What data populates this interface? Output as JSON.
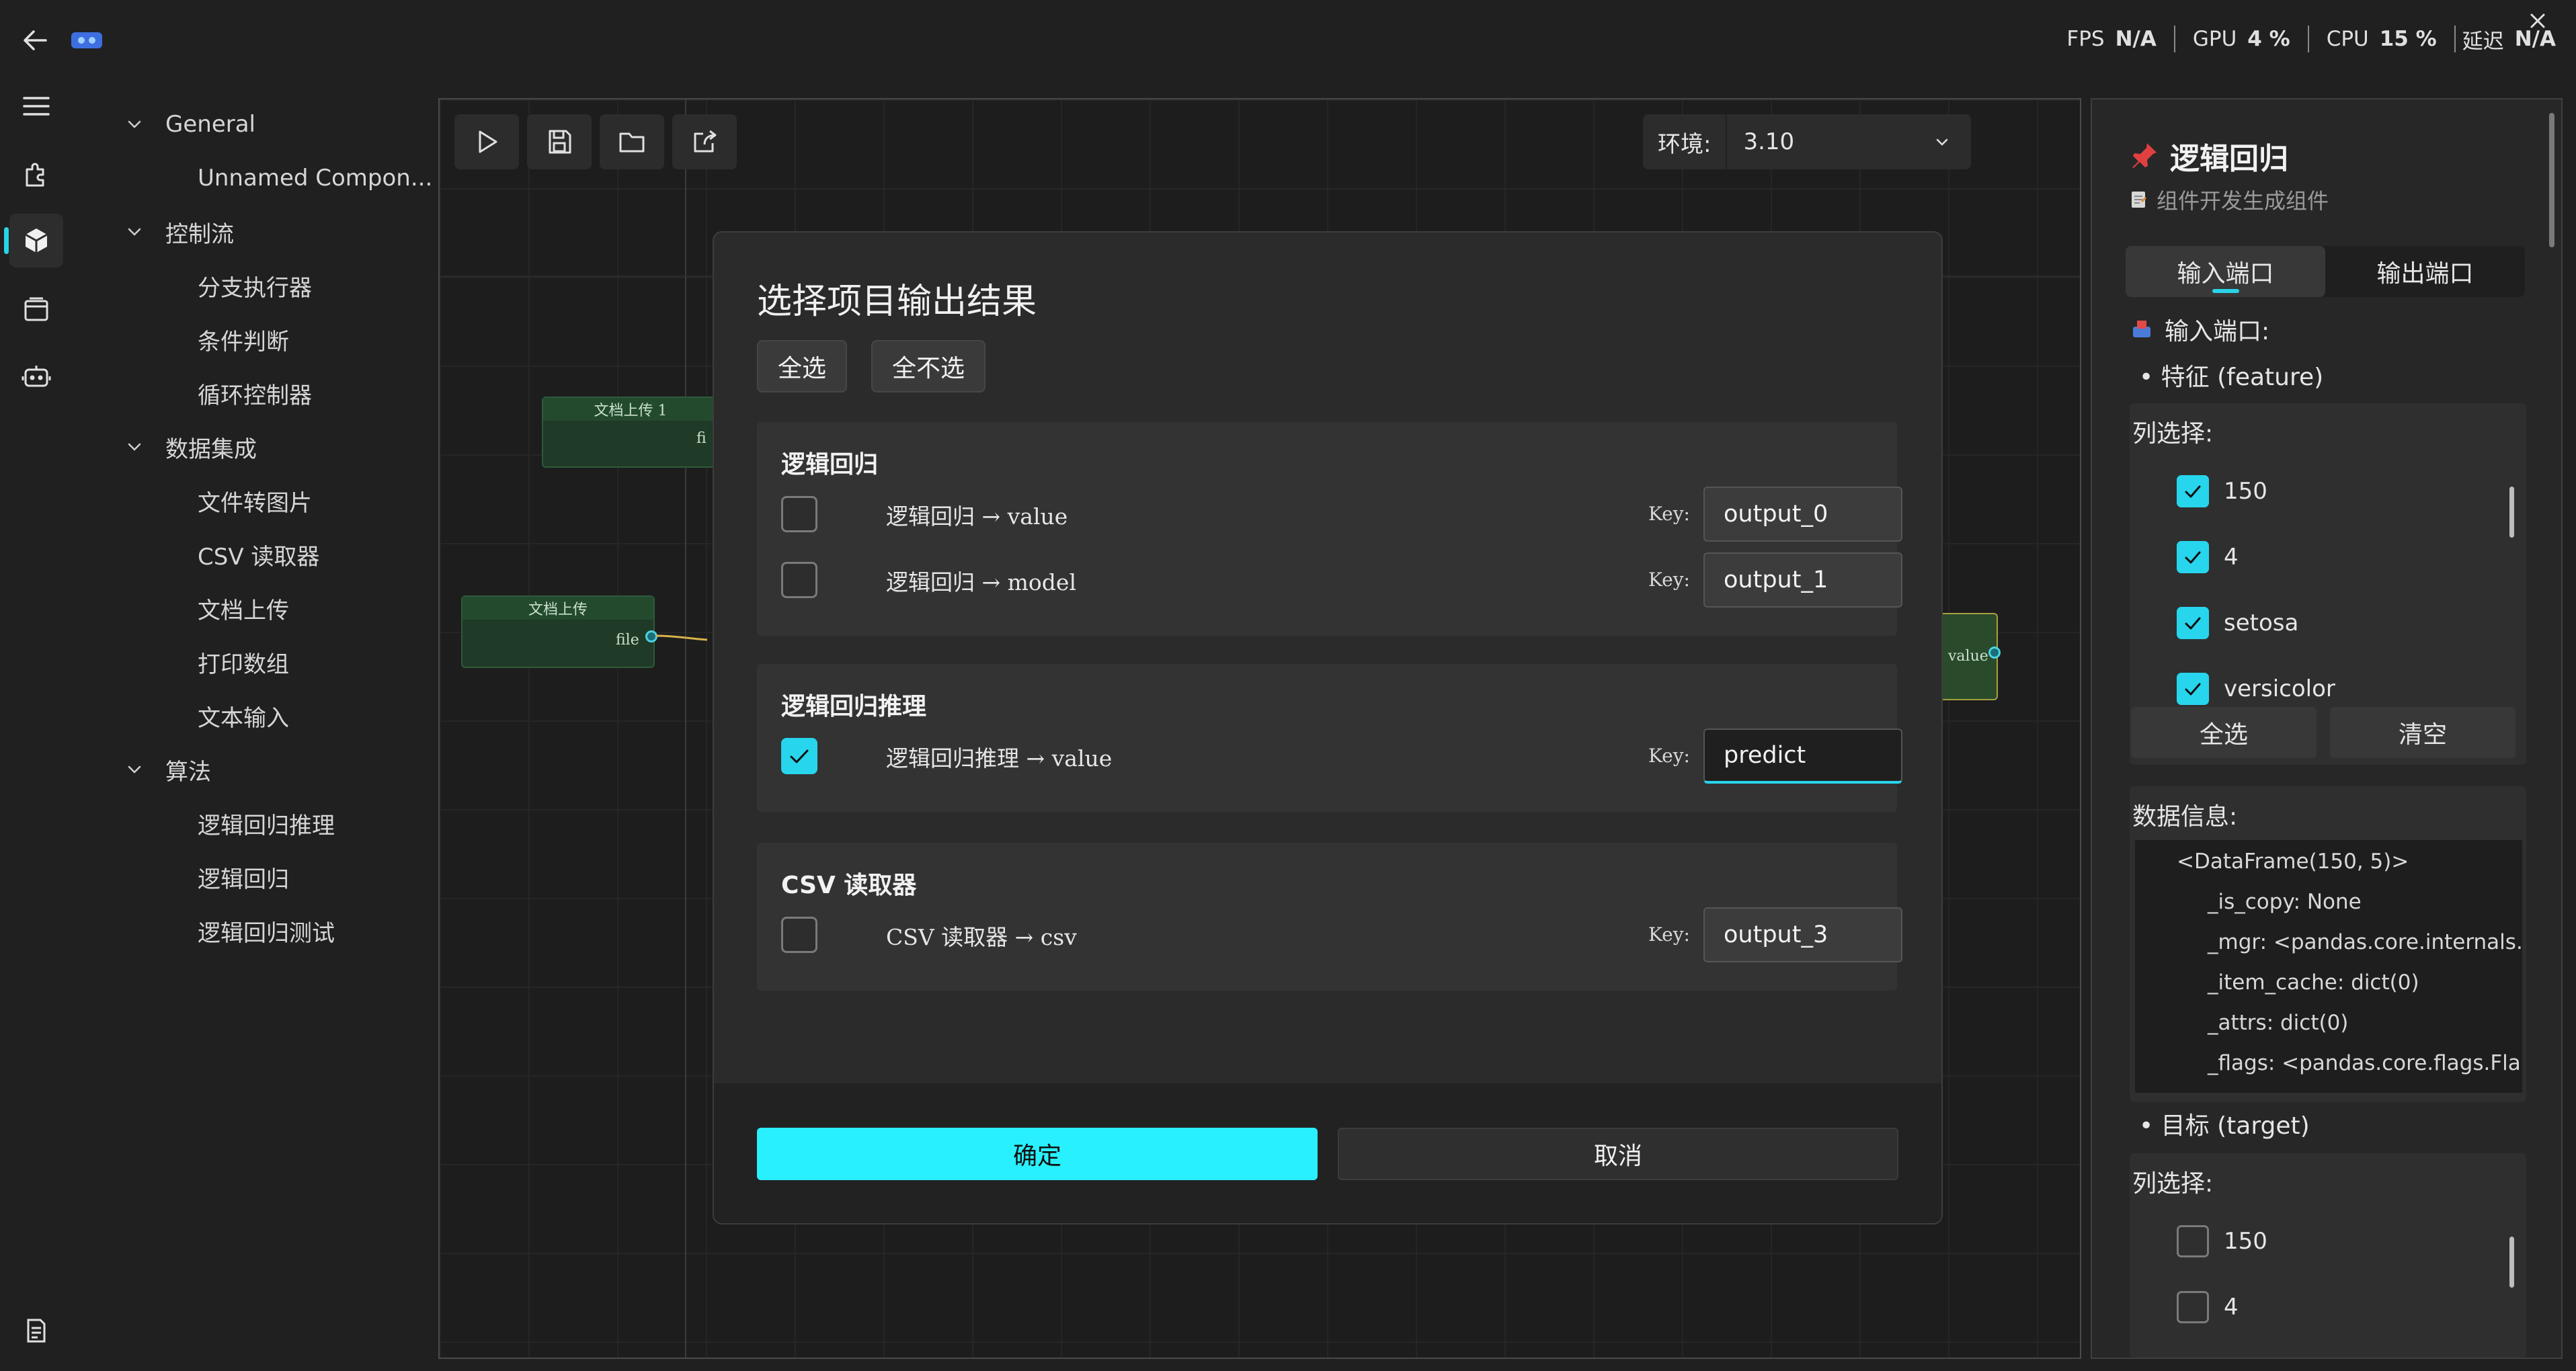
{
  "perf": {
    "fps_label": "FPS",
    "fps": "N/A",
    "gpu_label": "GPU",
    "gpu": "4 %",
    "cpu_label": "CPU",
    "cpu": "15 %",
    "latency_label": "延迟",
    "latency": "N/A"
  },
  "tree": [
    {
      "type": "cat",
      "label": "General"
    },
    {
      "type": "item",
      "label": "Unnamed Compon..."
    },
    {
      "type": "cat",
      "label": "控制流"
    },
    {
      "type": "item",
      "label": "分支执行器"
    },
    {
      "type": "item",
      "label": "条件判断"
    },
    {
      "type": "item",
      "label": "循环控制器"
    },
    {
      "type": "cat",
      "label": "数据集成"
    },
    {
      "type": "item",
      "label": "文件转图片"
    },
    {
      "type": "item",
      "label": "CSV 读取器"
    },
    {
      "type": "item",
      "label": "文档上传"
    },
    {
      "type": "item",
      "label": "打印数组"
    },
    {
      "type": "item",
      "label": "文本输入"
    },
    {
      "type": "cat",
      "label": "算法"
    },
    {
      "type": "item",
      "label": "逻辑回归推理"
    },
    {
      "type": "item",
      "label": "逻辑回归"
    },
    {
      "type": "item",
      "label": "逻辑回归测试"
    }
  ],
  "canvas": {
    "env_label": "环境:",
    "env_value": "3.10",
    "node1_title": "文档上传 1",
    "node1_port": "fi",
    "node2_title": "文档上传",
    "node2_port": "file",
    "node3_port": "value"
  },
  "dialog": {
    "title": "选择项目输出结果",
    "select_all": "全选",
    "select_none": "全不选",
    "key_label": "Key:",
    "groups": [
      {
        "title": "逻辑回归",
        "rows": [
          {
            "label": "逻辑回归 → value",
            "key": "output_0",
            "checked": false
          },
          {
            "label": "逻辑回归 → model",
            "key": "output_1",
            "checked": false
          }
        ]
      },
      {
        "title": "逻辑回归推理",
        "rows": [
          {
            "label": "逻辑回归推理 → value",
            "key": "predict",
            "checked": true
          }
        ]
      },
      {
        "title": "CSV 读取器",
        "rows": [
          {
            "label": "CSV 读取器 → csv",
            "key": "output_3",
            "checked": false
          }
        ]
      }
    ],
    "ok": "确定",
    "cancel": "取消"
  },
  "panel": {
    "title": "逻辑回归",
    "subtitle": "组件开发生成组件",
    "tab_input": "输入端口",
    "tab_output": "输出端口",
    "input_ports_label": "输入端口:",
    "feature_label": "• 特征 (feature)",
    "column_select_label": "列选择:",
    "feature_columns": [
      {
        "label": "150",
        "checked": true
      },
      {
        "label": "4",
        "checked": true
      },
      {
        "label": "setosa",
        "checked": true
      },
      {
        "label": "versicolor",
        "checked": true
      }
    ],
    "select_all": "全选",
    "clear": "清空",
    "data_info_label": "数据信息:",
    "data_info_lines": [
      "<DataFrame(150, 5)>",
      "_is_copy: None",
      "_mgr: <pandas.core.internals....",
      "_item_cache: dict(0)",
      "_attrs: dict(0)",
      "_flags: <pandas.core.flags.Fla..."
    ],
    "target_label": "• 目标 (target)",
    "target_columns": [
      {
        "label": "150",
        "checked": false
      },
      {
        "label": "4",
        "checked": false
      }
    ]
  },
  "colors": {
    "accent": "#29f0ff",
    "check": "#27d5ec",
    "node_green": "#1f3a26"
  }
}
